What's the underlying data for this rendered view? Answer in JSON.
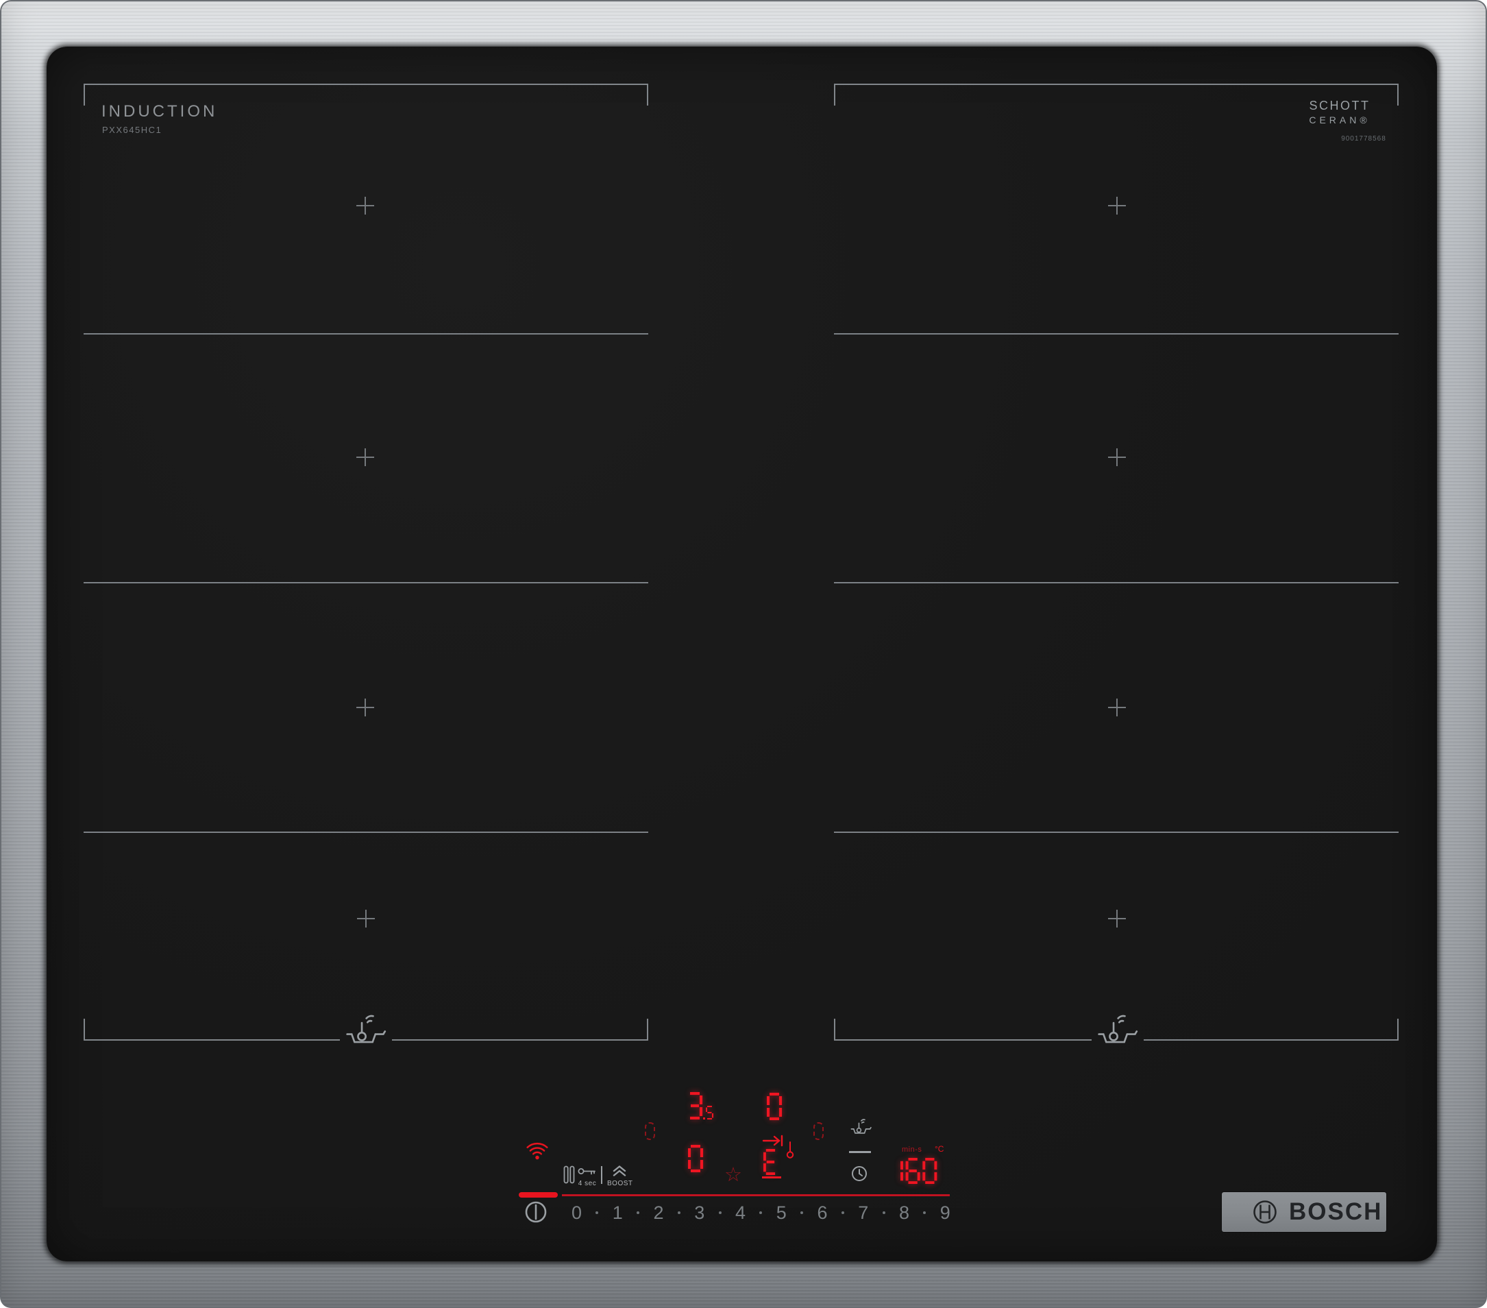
{
  "branding": {
    "induction_label": "INDUCTION",
    "model": "PXX645HC1",
    "glass_brand_line1": "SCHOTT",
    "glass_brand_line2": "CERAN®",
    "serial": "9001778568",
    "bosch_logo": "BOSCH"
  },
  "controls": {
    "key_hold_label": "4 sec",
    "boost_label": "BOOST",
    "digits": [
      "0",
      "1",
      "2",
      "3",
      "4",
      "5",
      "6",
      "7",
      "8",
      "9"
    ]
  },
  "displays": {
    "zone_level_main": "3",
    "zone_level_sub": "5",
    "zone_rear_level": "0",
    "zone_front_level": "0",
    "move_pan_char": "E",
    "timer_value": "160",
    "timer_unit": "min-s",
    "temp_unit": "°C"
  },
  "icons": [
    "wifi-icon",
    "pause-icon",
    "key-lock-icon",
    "boost-chevrons-icon",
    "power-icon",
    "clock-timer-icon",
    "pan-sensor-icon",
    "thermometer-icon",
    "move-pan-indicator",
    "star-icon",
    "flex-zone-dashes-icon",
    "plus-mark",
    "bosch-emblem-icon"
  ],
  "colors": {
    "led_red": "#ef1522",
    "dim_red": "#94161d",
    "zone_line_gray": "#81868b",
    "control_gray": "#9ba0a4",
    "steel": "#abafb4",
    "glass_black": "#191919"
  }
}
